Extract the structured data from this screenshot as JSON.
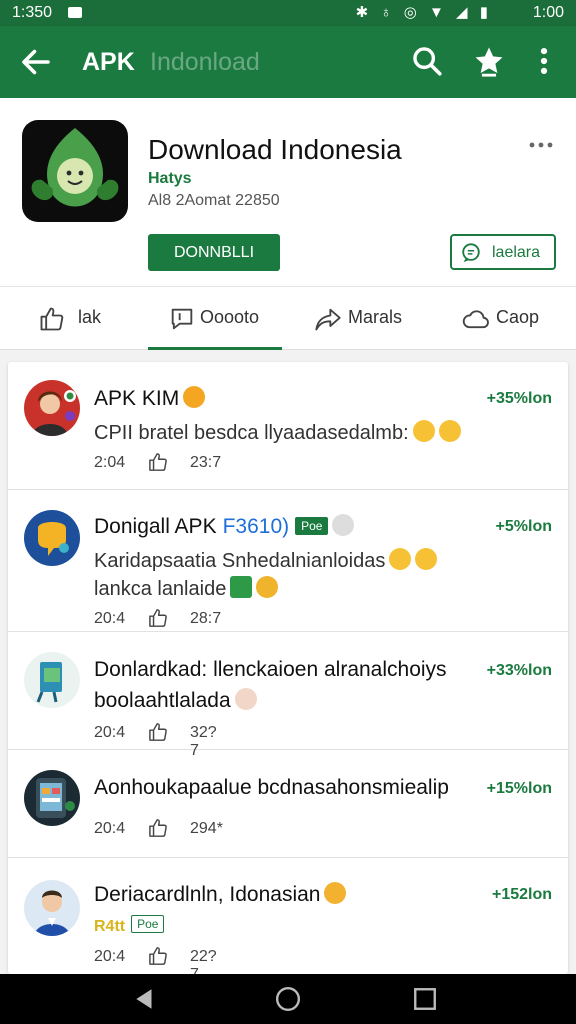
{
  "status": {
    "time_left": "1:350",
    "time_right": "1:00",
    "icons": "✱ ♁ ◎ ▼ ◢ ▮"
  },
  "appbar": {
    "title": "APK",
    "subtitle": "Indonload"
  },
  "app": {
    "name": "Download Indonesia",
    "developer": "Hatys",
    "meta": "Al8 2Aomat 22850",
    "install_label": "DONNBLLI",
    "ask_label": "laelara"
  },
  "actions": [
    {
      "label": "lak",
      "icon": "thumbs-up-icon"
    },
    {
      "label": "Ooooto",
      "icon": "comment-icon"
    },
    {
      "label": "Marals",
      "icon": "share-icon"
    },
    {
      "label": "Caop",
      "icon": "cloud-icon"
    }
  ],
  "feed": [
    {
      "name": "APK KIM",
      "lines": [
        "CPII bratel besdca llyaadasedalmb:"
      ],
      "delta": "+35%lon",
      "stat1": "2:04",
      "stat2": "23:7"
    },
    {
      "name": "Donigall APK",
      "tag": "F3610)",
      "badge": "Poe",
      "lines": [
        "Karidapsaatia Snhedalnianloidas",
        "lankca lanlaide"
      ],
      "delta": "+5%lon",
      "stat1": "20:4",
      "stat2": "28:7"
    },
    {
      "name": "Donlardkad: llenckaioen alranalchoiys",
      "lines": [
        "boolaahtlalada"
      ],
      "delta": "+33%lon",
      "stat1": "20:4",
      "stat2": "32?7"
    },
    {
      "name": "Aonhoukapaalue bcdnasahonsmiealip",
      "lines": [],
      "delta": "+15%lon",
      "stat1": "20:4",
      "stat2": "294*"
    },
    {
      "name": "Deriacardlnln, Idonasian",
      "tag_yellow": "R4tt",
      "badge": "Poe",
      "lines": [],
      "delta": "+152lon",
      "stat1": "20:4",
      "stat2": "22?7"
    }
  ],
  "colors": {
    "primary": "#1b7a3f",
    "status_bar": "#1b6e3a",
    "nav_bar": "#000000"
  }
}
